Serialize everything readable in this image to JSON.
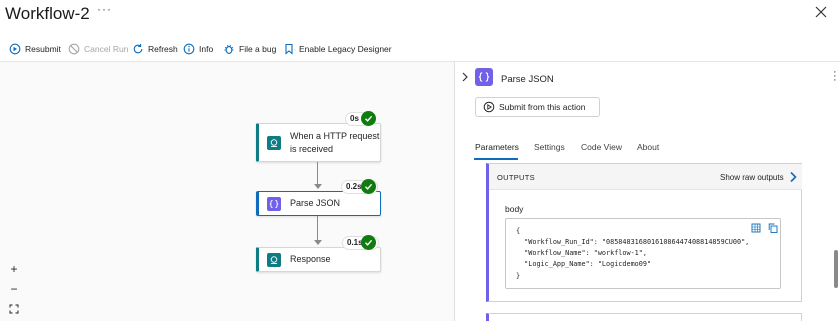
{
  "window": {
    "title": "Workflow-2",
    "more": "···"
  },
  "toolbar": {
    "resubmit": "Resubmit",
    "cancel_run": "Cancel Run",
    "refresh": "Refresh",
    "info": "Info",
    "file_bug": "File a bug",
    "legacy_designer": "Enable Legacy Designer"
  },
  "canvas": {
    "nodes": [
      {
        "label": "When a HTTP request is received",
        "duration": "0s",
        "status": "succeeded",
        "icon": "http-request-icon"
      },
      {
        "label": "Parse JSON",
        "duration": "0.2s",
        "status": "succeeded",
        "icon": "parse-json-icon"
      },
      {
        "label": "Response",
        "duration": "0.1s",
        "status": "succeeded",
        "icon": "response-icon"
      }
    ],
    "zoom_controls": {
      "zoom_in": "+",
      "zoom_out": "−"
    }
  },
  "panel": {
    "title": "Parse JSON",
    "submit_button": "Submit from this action",
    "tabs": [
      "Parameters",
      "Settings",
      "Code View",
      "About"
    ],
    "active_tab": "Parameters",
    "outputs": {
      "header": "OUTPUTS",
      "show_raw": "Show raw outputs",
      "body_label": "body",
      "code_lines": [
        "{",
        "  \"Workflow_Run_Id\": \"08584831680161086447408814859CU00\",",
        "  \"Workflow_Name\": \"workflow-1\",",
        "  \"Logic_App_Name\": \"Logicdemo09\"",
        "}"
      ]
    }
  },
  "colors": {
    "accent": "#0f6cbd",
    "success": "#107c10",
    "parse_json": "#7160e8",
    "http_teal": "#0f7b83"
  }
}
